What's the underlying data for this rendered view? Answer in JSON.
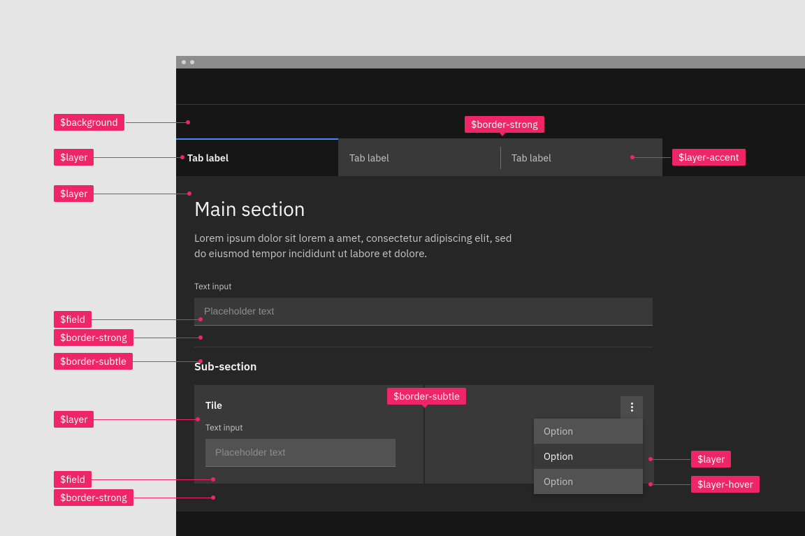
{
  "tokens": {
    "background": "$background",
    "layer": "$layer",
    "layer_accent": "$layer-accent",
    "layer_hover": "$layer-hover",
    "field": "$field",
    "border_strong": "$border-strong",
    "border_subtle": "$border-subtle"
  },
  "tabs": [
    {
      "label": "Tab label",
      "selected": true
    },
    {
      "label": "Tab label",
      "selected": false
    },
    {
      "label": "Tab label",
      "selected": false
    }
  ],
  "main": {
    "heading": "Main section",
    "body": "Lorem ipsum dolor sit lorem a amet, consectetur adipiscing elit, sed do eiusmod tempor incididunt ut labore et dolore.",
    "input_label": "Text input",
    "input_placeholder": "Placeholder text"
  },
  "sub": {
    "heading": "Sub-section",
    "tile_title": "Tile",
    "tile_input_label": "Text input",
    "tile_input_placeholder": "Placeholder text"
  },
  "menu": {
    "options": [
      "Option",
      "Option",
      "Option"
    ]
  }
}
